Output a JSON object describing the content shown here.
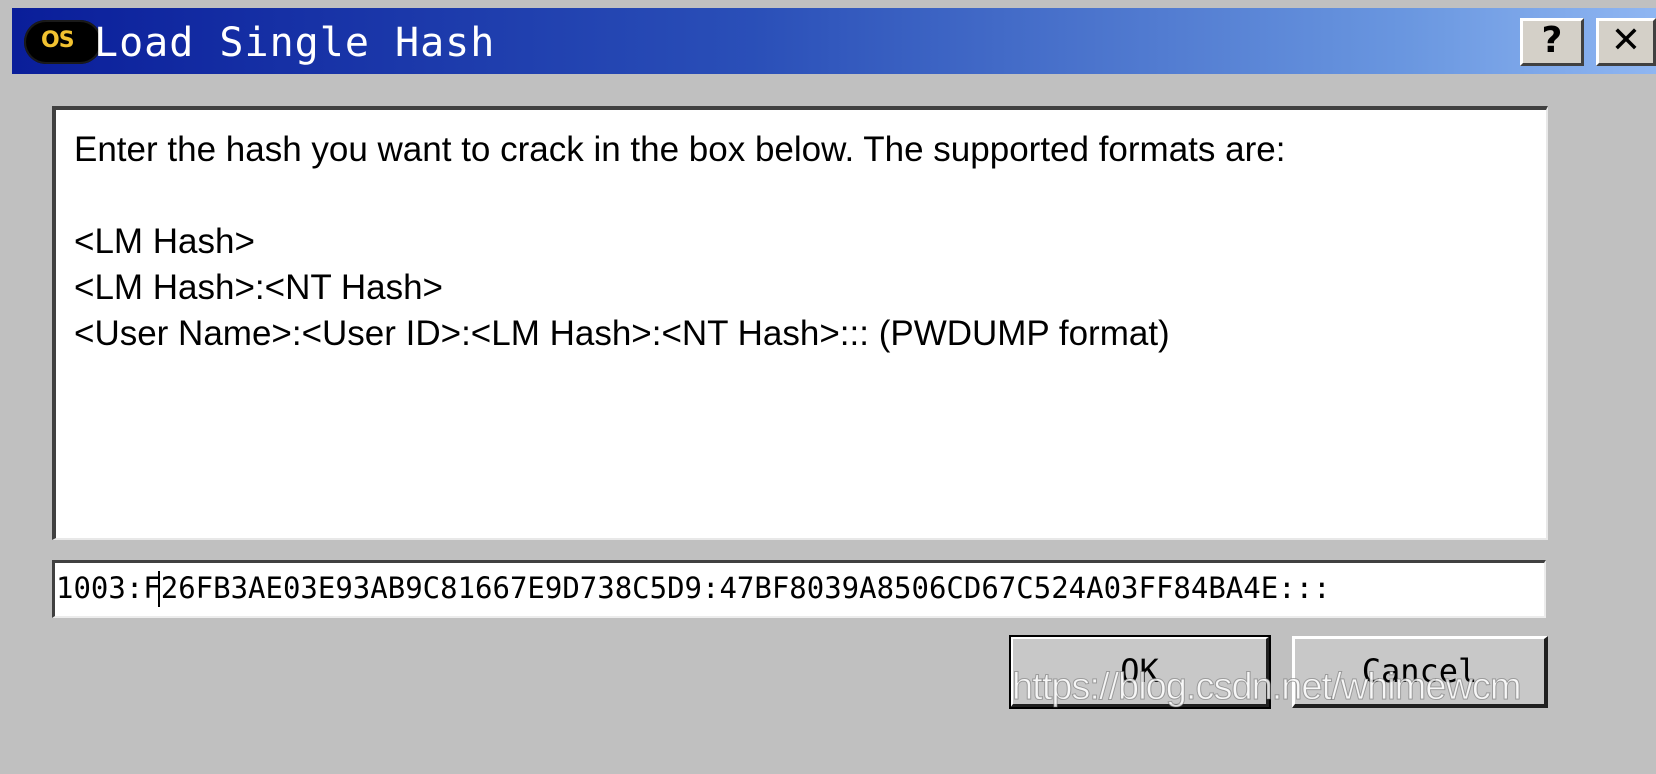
{
  "window": {
    "title": "Load Single Hash",
    "app_icon_text": "OS",
    "help_label": "?",
    "close_label": "✕"
  },
  "info": {
    "lines": [
      "Enter the hash you want to crack in the box below. The supported formats are:",
      "<LM Hash>",
      "<LM Hash>:<NT Hash>",
      "<User Name>:<User ID>:<LM Hash>:<NT Hash>::: (PWDUMP format)"
    ]
  },
  "hash_input": {
    "value": "1003:F26FB3AE03E93AB9C81667E9D738C5D9:47BF8039A8506CD67C524A03FF84BA4E:::"
  },
  "buttons": {
    "ok": "OK",
    "cancel": "Cancel"
  },
  "watermark": "https://blog.csdn.net/whimewcm",
  "colors": {
    "titlebar_start": "#0a1e9a",
    "titlebar_end": "#8fb6f2",
    "dialog_bg": "#c0c0c0"
  }
}
